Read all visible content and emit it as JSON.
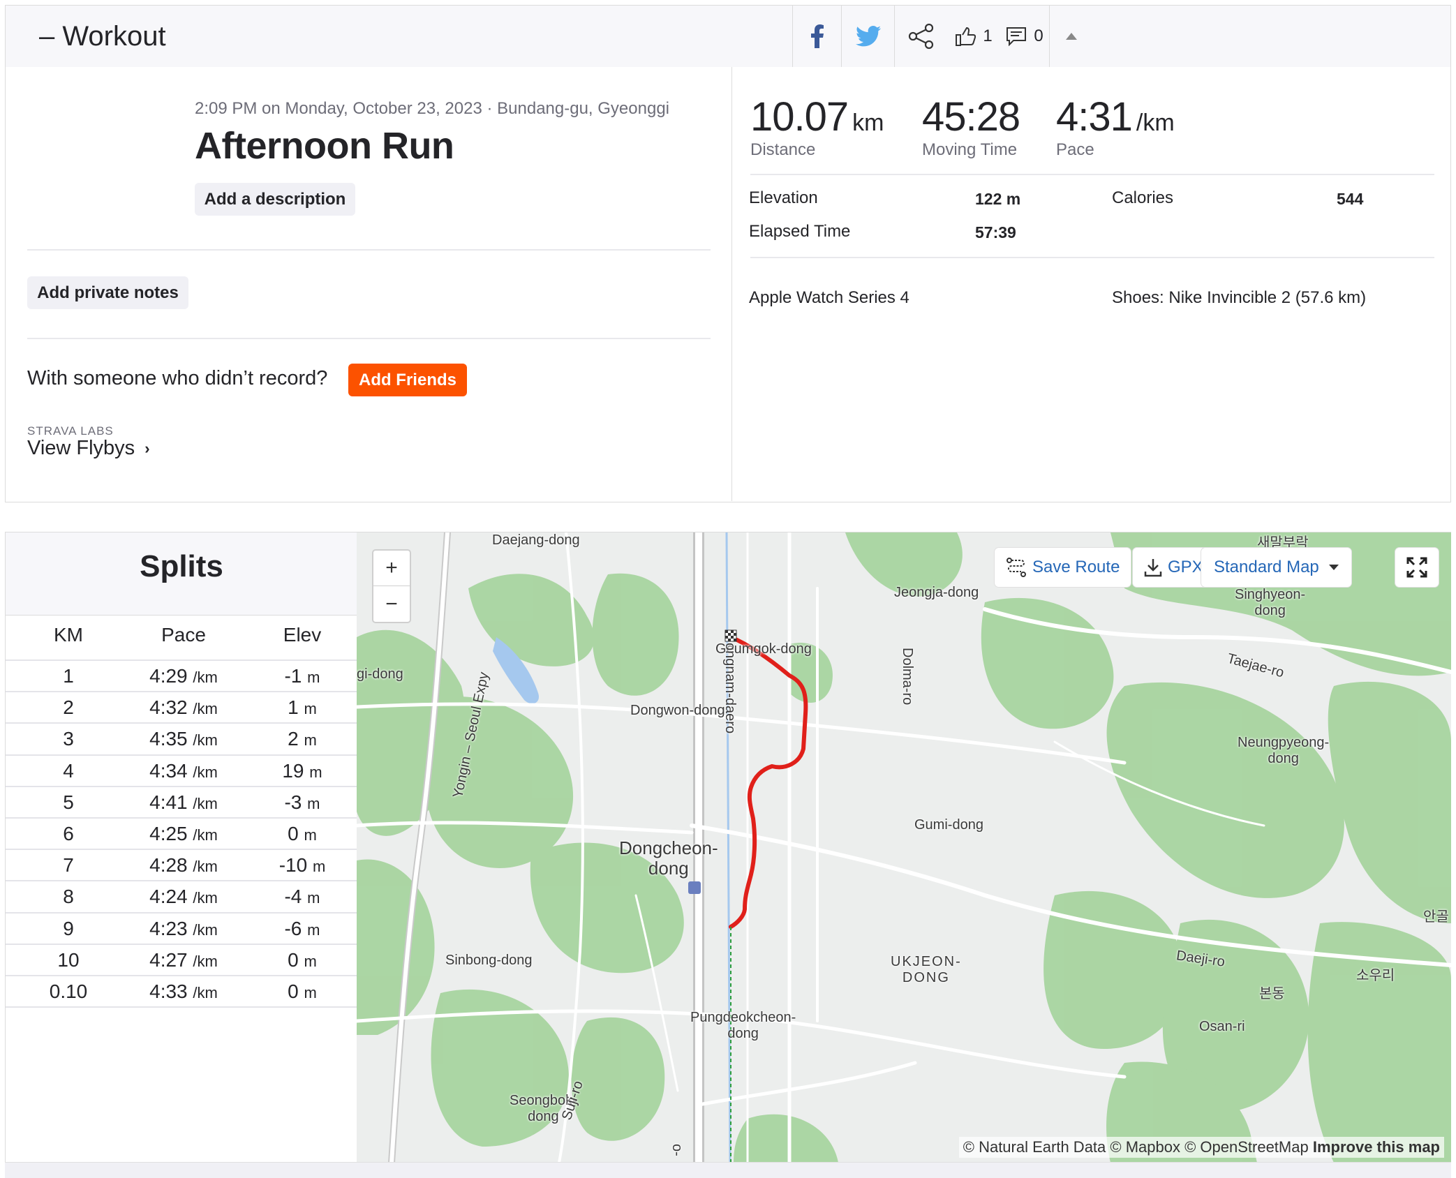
{
  "header": {
    "title": "– Workout",
    "kudos_count": "1",
    "comments_count": "0"
  },
  "activity": {
    "meta": "2:09 PM on Monday, October 23, 2023 · Bundang-gu, Gyeonggi",
    "title": "Afternoon Run",
    "add_description": "Add a description",
    "add_private_notes": "Add private notes",
    "with_someone": "With someone who didn’t record?",
    "add_friends": "Add Friends",
    "labs_label": "STRAVA LABS",
    "view_flybys": "View Flybys"
  },
  "stats": {
    "distance": {
      "value": "10.07",
      "unit": "km",
      "label": "Distance"
    },
    "moving_time": {
      "value": "45:28",
      "label": "Moving Time"
    },
    "pace": {
      "value": "4:31",
      "unit": "/km",
      "label": "Pace"
    },
    "elevation": {
      "label": "Elevation",
      "value": "122 m"
    },
    "elapsed": {
      "label": "Elapsed Time",
      "value": "57:39"
    },
    "calories": {
      "label": "Calories",
      "value": "544"
    },
    "device": "Apple Watch Series 4",
    "shoes": "Shoes: Nike Invincible 2 (57.6 km)"
  },
  "splits": {
    "title": "Splits",
    "columns": [
      "KM",
      "Pace",
      "Elev"
    ],
    "pace_unit": "/km",
    "elev_unit": "m",
    "rows": [
      {
        "km": "1",
        "pace": "4:29",
        "elev": "-1"
      },
      {
        "km": "2",
        "pace": "4:32",
        "elev": "1"
      },
      {
        "km": "3",
        "pace": "4:35",
        "elev": "2"
      },
      {
        "km": "4",
        "pace": "4:34",
        "elev": "19"
      },
      {
        "km": "5",
        "pace": "4:41",
        "elev": "-3"
      },
      {
        "km": "6",
        "pace": "4:25",
        "elev": "0"
      },
      {
        "km": "7",
        "pace": "4:28",
        "elev": "-10"
      },
      {
        "km": "8",
        "pace": "4:24",
        "elev": "-4"
      },
      {
        "km": "9",
        "pace": "4:23",
        "elev": "-6"
      },
      {
        "km": "10",
        "pace": "4:27",
        "elev": "0"
      },
      {
        "km": "0.10",
        "pace": "4:33",
        "elev": "0"
      }
    ]
  },
  "map": {
    "save_route": "Save Route",
    "gpx": "GPX",
    "map_type": "Standard Map",
    "zoom_in": "+",
    "zoom_out": "−",
    "attribution": "© Natural Earth Data © Mapbox © OpenStreetMap",
    "improve": "Improve this map",
    "labels": {
      "daejang": "Daejang-dong",
      "saemal": "새말부락",
      "jeongja": "Jeongja-dong",
      "singhyeon": "Singhyeon-\ndong",
      "geumgok": "Geumgok-dong",
      "gidong": "gi-dong",
      "dolma": "Dolma-ro",
      "taejae": "Taejae-ro",
      "yongin": "Yongin – Seoul Expy",
      "dongwon": "Dongwon-dong",
      "seongnam": "ongnam-daero",
      "neungpyeong": "Neungpyeong-\ndong",
      "gumi": "Gumi-dong",
      "dongcheon": "Dongcheon-\ndong",
      "angol": "안골",
      "sinbong": "Sinbong-dong",
      "ukjeon": "UKJEON-\nDONG",
      "daeji": "Daeji-ro",
      "sowoori": "소우리",
      "bondong": "본동",
      "pungdeok": "Pungdeokcheon-\ndong",
      "osanri": "Osan-ri",
      "seongbok": "Seongbok-\ndong",
      "suji": "Suji-ro",
      "road_o": "o-"
    },
    "route_color": "#e0201a"
  }
}
